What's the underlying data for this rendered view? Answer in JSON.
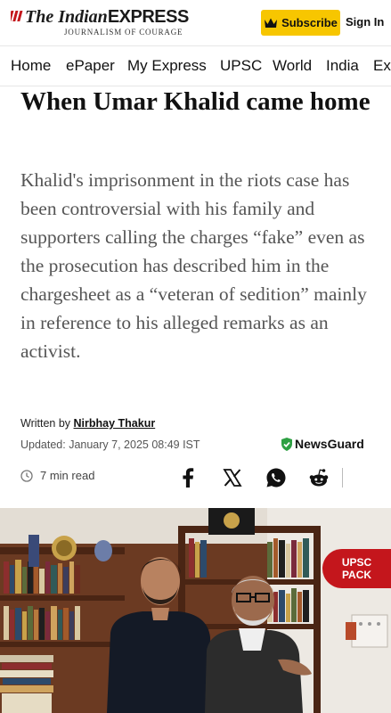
{
  "header": {
    "logo": {
      "part_the": "The ",
      "part_indian": "Indian",
      "part_express": "EXPRESS",
      "tagline": "JOURNALISM OF COURAGE"
    },
    "subscribe_label": "Subscribe",
    "signin_label": "Sign In"
  },
  "nav": {
    "items": [
      "Home",
      "ePaper",
      "My Express",
      "UPSC",
      "World",
      "India",
      "Ex"
    ]
  },
  "article": {
    "headline": "When Umar Khalid came home",
    "synopsis": "Khalid's imprisonment in the riots case has been controversial with his family and supporters calling the charges “fake” even as the prosecution has described him in the chargesheet as a “veteran of sedition” mainly in reference to his alleged remarks as an activist.",
    "byline_prefix": "Written by ",
    "author": "Nirbhay Thakur",
    "updated": "Updated: January 7, 2025 08:49 IST",
    "newsguard_label": "NewsGuard",
    "read_time": "7 min read"
  },
  "share": {
    "icons": [
      "facebook-icon",
      "x-icon",
      "whatsapp-icon",
      "reddit-icon"
    ]
  },
  "badge": {
    "line1": "UPSC",
    "line2": "PACK"
  },
  "colors": {
    "brand_red": "#c4161c",
    "subscribe_yellow": "#f7c600",
    "newsguard_green": "#2ea043"
  }
}
